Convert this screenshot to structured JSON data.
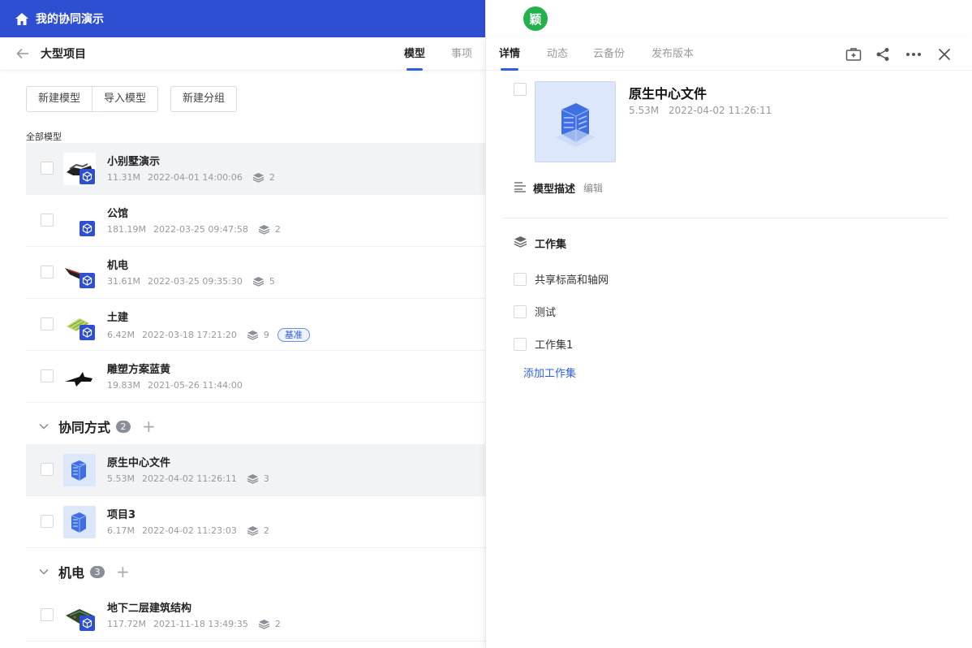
{
  "titlebar": {
    "title": "我的协同演示",
    "avatar_text": "颖",
    "icons": [
      "home-icon",
      "bell-icon",
      "gear-icon",
      "cloud-upload-icon",
      "minimize-icon",
      "maximize-icon",
      "close-icon"
    ],
    "bg_color": "#2f4fd3"
  },
  "left": {
    "project_title": "大型项目",
    "tabs": [
      {
        "label": "模型",
        "active": true
      },
      {
        "label": "事项",
        "active": false
      }
    ],
    "buttons": {
      "new_model": "新建模型",
      "import_model": "导入模型",
      "new_group": "新建分组"
    },
    "all_models_label": "全部模型",
    "models": [
      {
        "name": "小别墅演示",
        "size": "11.31M",
        "date": "2022-04-01 14:00:06",
        "layers": "2"
      },
      {
        "name": "公馆",
        "size": "181.19M",
        "date": "2022-03-25 09:47:58",
        "layers": "2"
      },
      {
        "name": "机电",
        "size": "31.61M",
        "date": "2022-03-25 09:35:30",
        "layers": "5"
      },
      {
        "name": "土建",
        "size": "6.42M",
        "date": "2022-03-18 17:21:20",
        "layers": "9",
        "tag": "基准"
      },
      {
        "name": "雕塑方案蓝黄",
        "size": "19.83M",
        "date": "2021-05-26 11:44:00"
      }
    ],
    "groups": [
      {
        "name": "协同方式",
        "count": "2",
        "items": [
          {
            "name": "原生中心文件",
            "size": "5.53M",
            "date": "2022-04-02 11:26:11",
            "layers": "3",
            "selected": true
          },
          {
            "name": "项目3",
            "size": "6.17M",
            "date": "2022-04-02 11:23:03",
            "layers": "2"
          }
        ]
      },
      {
        "name": "机电",
        "count": "3",
        "items": [
          {
            "name": "地下二层建筑结构",
            "size": "117.72M",
            "date": "2021-11-18 13:49:35",
            "layers": "2"
          }
        ]
      }
    ]
  },
  "detail": {
    "tabs": [
      {
        "label": "详情",
        "active": true
      },
      {
        "label": "动态"
      },
      {
        "label": "云备份"
      },
      {
        "label": "发布版本"
      }
    ],
    "name": "原生中心文件",
    "size": "5.53M",
    "date": "2022-04-02 11:26:11",
    "description_label": "模型描述",
    "edit_label": "编辑",
    "workset_label": "工作集",
    "worksets": [
      "共享标高和轴网",
      "测试",
      "工作集1"
    ],
    "add_workset": "添加工作集"
  },
  "colors": {
    "accent": "#2f5fe0",
    "selected_row": "#f2f3f5"
  }
}
